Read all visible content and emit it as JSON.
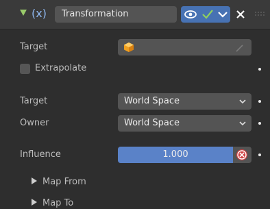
{
  "header": {
    "collapse_icon": "triangle-down-icon",
    "type_icon_text": "(x)",
    "name_value": "Transformation",
    "visibility_icon": "eye-icon",
    "apply_icon": "checkmark-icon",
    "menu_icon": "chevron-down-icon",
    "delete_icon": "close-icon",
    "grip_icon": "drag-grip-icon"
  },
  "fields": {
    "target_label": "Target",
    "target_icon": "object-cube-icon",
    "target_picker_icon": "eyedropper-icon",
    "extrapolate_label": "Extrapolate",
    "target_space_label": "Target",
    "target_space_value": "World Space",
    "owner_space_label": "Owner",
    "owner_space_value": "World Space",
    "influence_label": "Influence",
    "influence_value": "1.000",
    "influence_clear_icon": "x-circle-icon"
  },
  "subpanels": {
    "map_from_label": "Map From",
    "map_to_label": "Map To"
  },
  "colors": {
    "accent": "#4772b3",
    "influence_fill": "#5a82c8",
    "clear_red": "#d14343",
    "check_green": "#8fd05f",
    "arrow_green": "#9acb6b"
  }
}
